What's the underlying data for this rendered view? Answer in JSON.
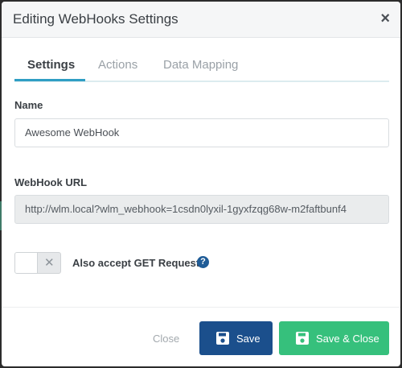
{
  "dialog": {
    "title": "Editing WebHooks Settings",
    "close_symbol": "×"
  },
  "tabs": [
    {
      "label": "Settings",
      "active": true
    },
    {
      "label": "Actions",
      "active": false
    },
    {
      "label": "Data Mapping",
      "active": false
    }
  ],
  "form": {
    "name_label": "Name",
    "name_value": "Awesome WebHook",
    "url_label": "WebHook URL",
    "url_value": "http://wlm.local?wlm_webhook=1csdn0lyxil-1gyxfzqg68w-m2faftbunf4",
    "get_toggle": {
      "label": "Also accept GET Requests",
      "enabled": false,
      "off_symbol": "✕"
    },
    "help_symbol": "?"
  },
  "footer": {
    "close_label": "Close",
    "save_label": "Save",
    "save_close_label": "Save & Close"
  },
  "icons": {
    "close": "close-icon",
    "help": "help-icon",
    "save": "floppy-disk-icon"
  },
  "colors": {
    "accent": "#2f9ec4",
    "save_button": "#1b4f8c",
    "save_close_button": "#36c07c",
    "help_icon": "#1f5c97"
  }
}
